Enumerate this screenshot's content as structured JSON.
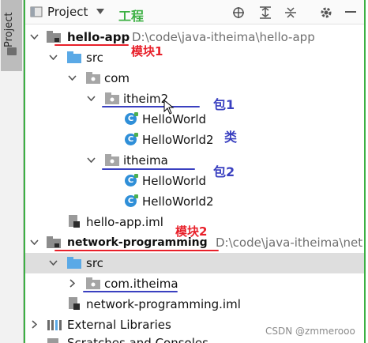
{
  "stripe": {
    "label": "Project"
  },
  "header": {
    "title": "Project",
    "annotation": "工程"
  },
  "tree": {
    "hello_app": {
      "name": "hello-app",
      "path": "D:\\code\\java-itheima\\hello-app"
    },
    "src1": "src",
    "com": "com",
    "itheim2": "itheim2",
    "helloworld_a": "HelloWorld",
    "helloworld2_a": "HelloWorld2",
    "itheima": "itheima",
    "helloworld_b": "HelloWorld",
    "helloworld2_b": "HelloWorld2",
    "hello_iml": "hello-app.iml",
    "network": {
      "name": "network-programming",
      "path": "D:\\code\\java-itheima\\net"
    },
    "src2": "src",
    "com_itheima": "com.itheima",
    "network_iml": "network-programming.iml",
    "external_libraries": "External Libraries",
    "scratches": "Scratches and Consoles"
  },
  "annotations": {
    "module1": "模块1",
    "package1": "包1",
    "class": "类",
    "package2": "包2",
    "module2": "模块2"
  },
  "watermark": "CSDN @zmmerooo",
  "colors": {
    "annotation_red": "#e8202a",
    "annotation_blue": "#3a40c0",
    "frame_green": "#3cb043"
  }
}
